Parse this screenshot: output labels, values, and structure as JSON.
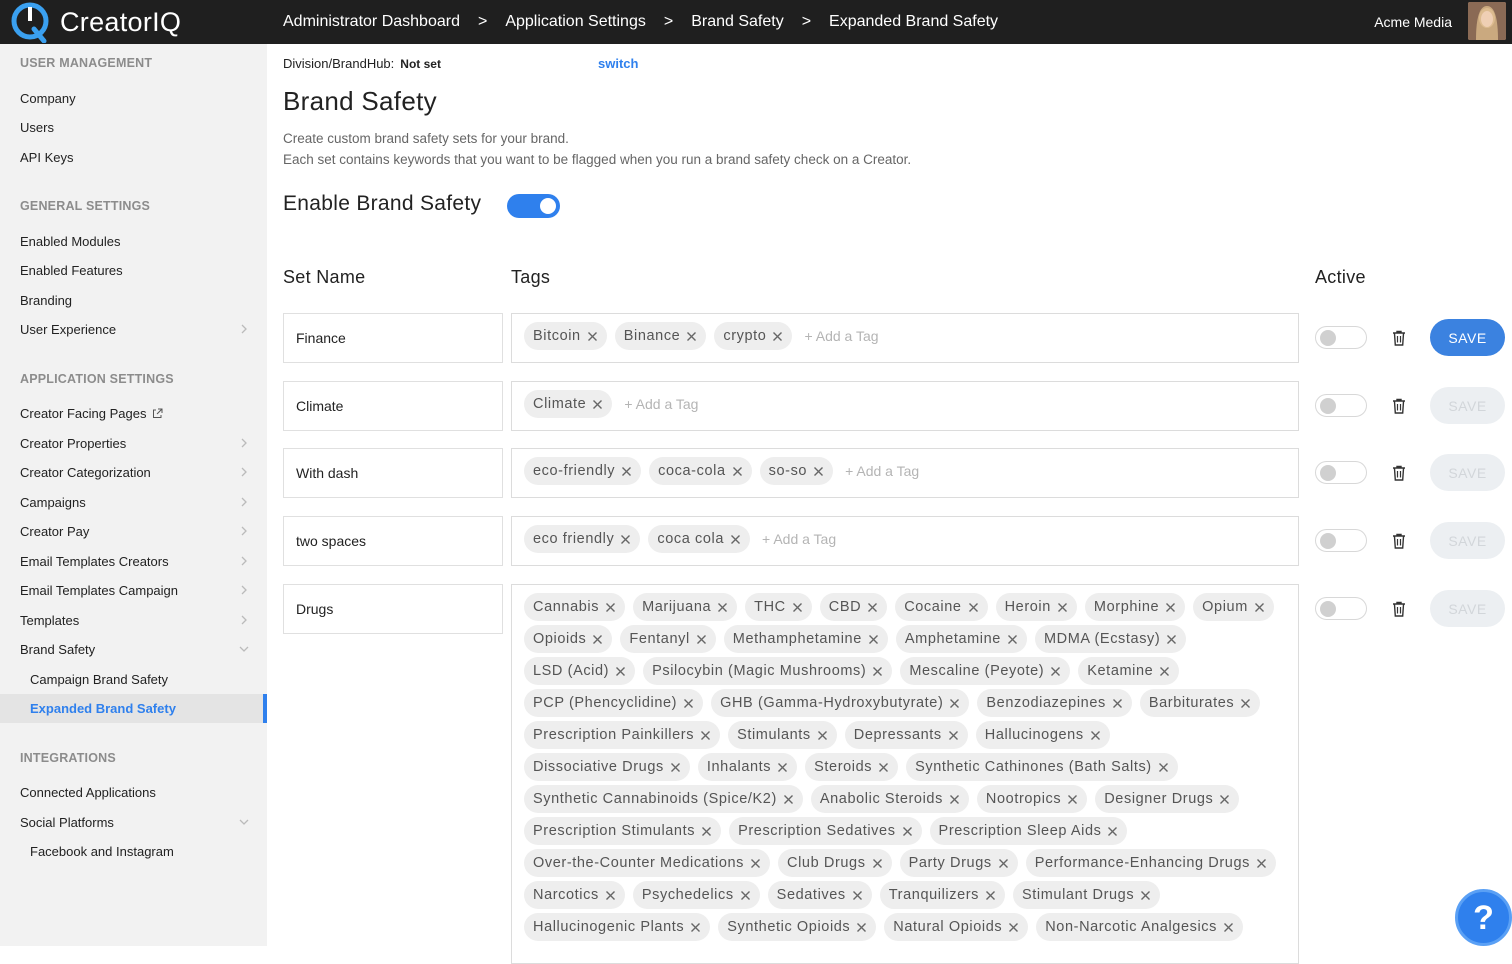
{
  "header": {
    "logo_text": "CreatorIQ",
    "breadcrumbs": [
      "Administrator Dashboard",
      "Application Settings",
      "Brand Safety",
      "Expanded Brand Safety"
    ],
    "separator": ">",
    "account_name": "Acme Media"
  },
  "sidebar": {
    "sections": [
      {
        "title": "USER MANAGEMENT",
        "items": [
          {
            "label": "Company"
          },
          {
            "label": "Users"
          },
          {
            "label": "API Keys"
          }
        ]
      },
      {
        "title": "GENERAL SETTINGS",
        "items": [
          {
            "label": "Enabled Modules"
          },
          {
            "label": "Enabled Features"
          },
          {
            "label": "Branding"
          },
          {
            "label": "User Experience"
          }
        ]
      },
      {
        "title": "APPLICATION SETTINGS",
        "items": [
          {
            "label": "Creator Facing Pages"
          },
          {
            "label": "Creator Properties"
          },
          {
            "label": "Creator Categorization"
          },
          {
            "label": "Campaigns"
          },
          {
            "label": "Creator Pay"
          },
          {
            "label": "Email Templates Creators"
          },
          {
            "label": "Email Templates Campaign"
          },
          {
            "label": "Templates"
          },
          {
            "label": "Brand Safety"
          },
          {
            "label": "Campaign Brand Safety"
          },
          {
            "label": "Expanded Brand Safety"
          }
        ]
      },
      {
        "title": "INTEGRATIONS",
        "items": [
          {
            "label": "Connected Applications"
          },
          {
            "label": "Social Platforms"
          },
          {
            "label": "Facebook and Instagram"
          }
        ]
      }
    ]
  },
  "main": {
    "division_label": "Division/BrandHub:",
    "division_value": "Not set",
    "switch_label": "switch",
    "title": "Brand Safety",
    "description_line1": "Create custom brand safety sets for your brand.",
    "description_line2": "Each set contains keywords that you want to be flagged when you run a brand safety check on a Creator.",
    "enable_label": "Enable Brand Safety",
    "enable_on": true,
    "col_set_name": "Set Name",
    "col_tags": "Tags",
    "col_active": "Active",
    "add_tag_placeholder": "+ Add a Tag",
    "save_label": "SAVE",
    "sets": [
      {
        "name": "Finance",
        "tags": [
          "Bitcoin",
          "Binance",
          "crypto"
        ],
        "active": false,
        "save_enabled": true
      },
      {
        "name": "Climate",
        "tags": [
          "Climate"
        ],
        "active": false,
        "save_enabled": false
      },
      {
        "name": "With dash",
        "tags": [
          "eco-friendly",
          "coca-cola",
          "so-so"
        ],
        "active": false,
        "save_enabled": false
      },
      {
        "name": "two spaces",
        "tags": [
          "eco friendly",
          "coca cola"
        ],
        "active": false,
        "save_enabled": false
      },
      {
        "name": "Drugs",
        "tags": [
          "Cannabis",
          "Marijuana",
          "THC",
          "CBD",
          "Cocaine",
          "Heroin",
          "Morphine",
          "Opium",
          "Opioids",
          "Fentanyl",
          "Methamphetamine",
          "Amphetamine",
          "MDMA (Ecstasy)",
          "LSD (Acid)",
          "Psilocybin (Magic Mushrooms)",
          "Mescaline (Peyote)",
          "Ketamine",
          "PCP (Phencyclidine)",
          "GHB (Gamma-Hydroxybutyrate)",
          "Benzodiazepines",
          "Barbiturates",
          "Prescription Painkillers",
          "Stimulants",
          "Depressants",
          "Hallucinogens",
          "Dissociative Drugs",
          "Inhalants",
          "Steroids",
          "Synthetic Cathinones (Bath Salts)",
          "Synthetic Cannabinoids (Spice/K2)",
          "Anabolic Steroids",
          "Nootropics",
          "Designer Drugs",
          "Prescription Stimulants",
          "Prescription Sedatives",
          "Prescription Sleep Aids",
          "Over-the-Counter Medications",
          "Club Drugs",
          "Party Drugs",
          "Performance-Enhancing Drugs",
          "Narcotics",
          "Psychedelics",
          "Sedatives",
          "Tranquilizers",
          "Stimulant Drugs",
          "Hallucinogenic Plants",
          "Synthetic Opioids",
          "Natural Opioids",
          "Non-Narcotic Analgesics"
        ],
        "active": false,
        "save_enabled": false
      }
    ]
  },
  "help_label": "?",
  "colors": {
    "accent": "#2f80ed",
    "topbar": "#1f1f1f",
    "sidebar": "#f2f2f2"
  }
}
